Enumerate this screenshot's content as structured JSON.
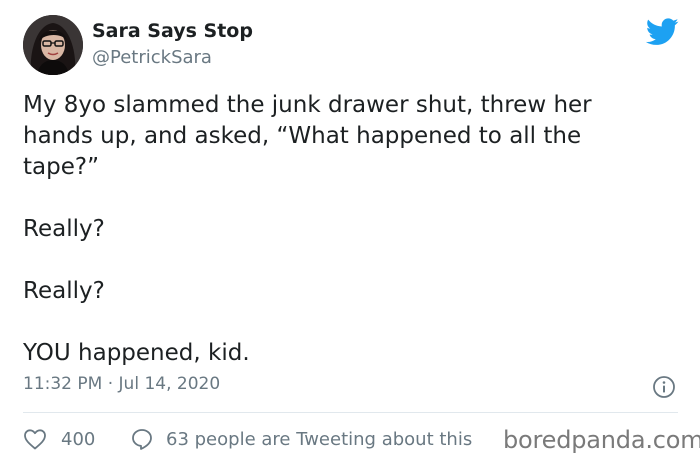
{
  "author": {
    "display_name": "Sara Says Stop",
    "handle": "@PetrickSara"
  },
  "tweet": {
    "lines": [
      "My 8yo slammed the junk drawer shut, threw her",
      "hands up, and asked, “What happened to all the",
      "tape?”",
      "Really?",
      "Really?",
      "YOU happened, kid."
    ],
    "timestamp": "11:32 PM · Jul 14, 2020"
  },
  "engagement": {
    "likes": "400",
    "conversation": "63 people are Tweeting about this"
  },
  "watermark": "boredpanda.com",
  "icons": {
    "brand": "twitter-bird-icon",
    "info": "info-icon",
    "like": "heart-icon",
    "reply": "speech-bubble-icon"
  },
  "colors": {
    "twitter_blue": "#1da1f2",
    "secondary_text": "#697882",
    "primary_text": "#1c2022",
    "divider": "#e1e8ed"
  }
}
